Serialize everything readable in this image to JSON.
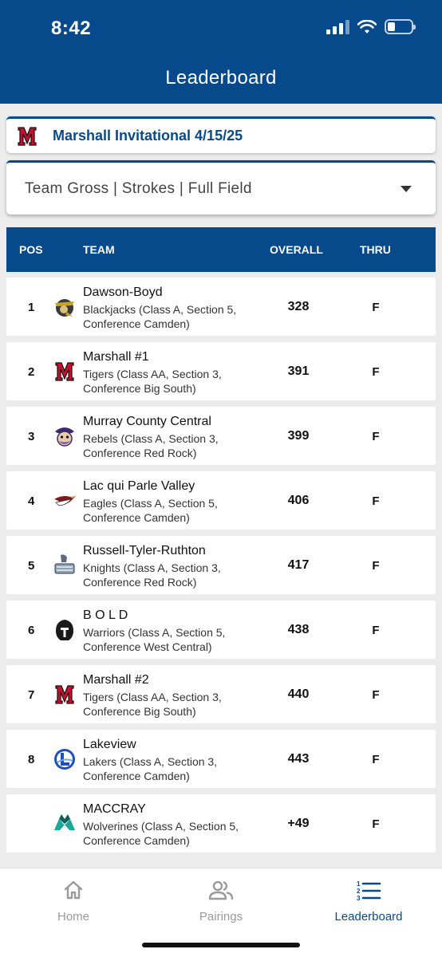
{
  "status_bar": {
    "time": "8:42"
  },
  "header": {
    "title": "Leaderboard"
  },
  "event": {
    "title": "Marshall Invitational 4/15/25"
  },
  "filter": {
    "label": "Team Gross | Strokes | Full Field"
  },
  "table": {
    "columns": {
      "pos": "POS",
      "team": "TEAM",
      "overall": "OVERALL",
      "thru": "THRU"
    },
    "rows": [
      {
        "pos": "1",
        "name": "Dawson-Boyd",
        "detail": "Blackjacks (Class A, Section 5, Conference Camden)",
        "overall": "328",
        "thru": "F",
        "logo": "blackjacks-logo-icon"
      },
      {
        "pos": "2",
        "name": "Marshall #1",
        "detail": "Tigers (Class AA, Section 3, Conference Big South)",
        "overall": "391",
        "thru": "F",
        "logo": "marshall-m-logo-icon"
      },
      {
        "pos": "3",
        "name": "Murray County Central",
        "detail": "Rebels (Class A, Section 3, Conference Red Rock)",
        "overall": "399",
        "thru": "F",
        "logo": "rebels-logo-icon"
      },
      {
        "pos": "4",
        "name": "Lac qui Parle Valley",
        "detail": "Eagles (Class A, Section 5, Conference Camden)",
        "overall": "406",
        "thru": "F",
        "logo": "eagles-logo-icon"
      },
      {
        "pos": "5",
        "name": "Russell-Tyler-Ruthton",
        "detail": "Knights (Class A, Section 3, Conference Red Rock)",
        "overall": "417",
        "thru": "F",
        "logo": "knights-logo-icon"
      },
      {
        "pos": "6",
        "name": "B O L D",
        "detail": "Warriors (Class A, Section 5, Conference West Central)",
        "overall": "438",
        "thru": "F",
        "logo": "warriors-logo-icon"
      },
      {
        "pos": "7",
        "name": "Marshall #2",
        "detail": "Tigers (Class AA, Section 3, Conference Big South)",
        "overall": "440",
        "thru": "F",
        "logo": "marshall-m-logo-icon"
      },
      {
        "pos": "8",
        "name": "Lakeview",
        "detail": "Lakers (Class A, Section 3, Conference Camden)",
        "overall": "443",
        "thru": "F",
        "logo": "lakers-logo-icon"
      },
      {
        "pos": "",
        "name": "MACCRAY",
        "detail": "Wolverines (Class A, Section 5, Conference Camden)",
        "overall": "+49",
        "thru": "F",
        "logo": "wolverines-logo-icon"
      }
    ]
  },
  "nav": {
    "home": "Home",
    "pairings": "Pairings",
    "leaderboard": "Leaderboard",
    "active": "leaderboard"
  },
  "colors": {
    "brand": "#074a8c",
    "marshall_red": "#c8102e"
  }
}
